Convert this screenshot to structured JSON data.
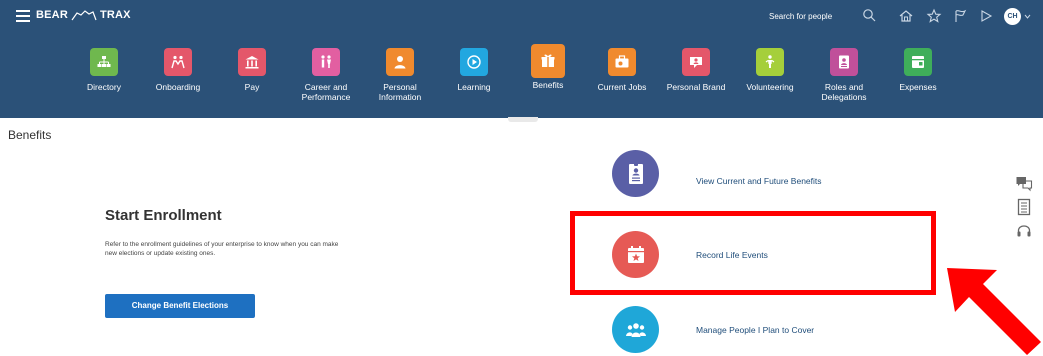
{
  "header": {
    "brand_left": "BEAR",
    "brand_right": "TRAX",
    "search_placeholder": "Search for people",
    "avatar_initials": "CH"
  },
  "nav": {
    "items": [
      {
        "label": "Directory",
        "color": "#6fb84e",
        "icon": "directory-icon"
      },
      {
        "label": "Onboarding",
        "color": "#e4576a",
        "icon": "onboarding-icon"
      },
      {
        "label": "Pay",
        "color": "#e4576a",
        "icon": "pay-icon"
      },
      {
        "label": "Career and Performance",
        "color": "#e25fa1",
        "icon": "career-icon"
      },
      {
        "label": "Personal Information",
        "color": "#f08a2e",
        "icon": "person-icon"
      },
      {
        "label": "Learning",
        "color": "#22a7e0",
        "icon": "learning-icon"
      },
      {
        "label": "Benefits",
        "color": "#f08a2e",
        "icon": "benefits-icon"
      },
      {
        "label": "Current Jobs",
        "color": "#f08a2e",
        "icon": "jobs-icon"
      },
      {
        "label": "Personal Brand",
        "color": "#e4576a",
        "icon": "brand-icon"
      },
      {
        "label": "Volunteering",
        "color": "#a5cf3b",
        "icon": "volunteering-icon"
      },
      {
        "label": "Roles and Delegations",
        "color": "#c0509a",
        "icon": "roles-icon"
      },
      {
        "label": "Expenses",
        "color": "#3fae5a",
        "icon": "expenses-icon"
      }
    ]
  },
  "page": {
    "title": "Benefits"
  },
  "enrollment": {
    "title": "Start Enrollment",
    "description": "Refer to the enrollment guidelines of your enterprise to know when you can make new elections or update existing ones.",
    "button_label": "Change Benefit Elections"
  },
  "actions": [
    {
      "label": "View Current and Future Benefits",
      "color": "#5a5fa6",
      "icon": "benefits-document-icon"
    },
    {
      "label": "Record Life Events",
      "color": "#e65a55",
      "icon": "calendar-star-icon"
    },
    {
      "label": "Manage People I Plan to Cover",
      "color": "#1fa7d8",
      "icon": "people-group-icon"
    }
  ]
}
